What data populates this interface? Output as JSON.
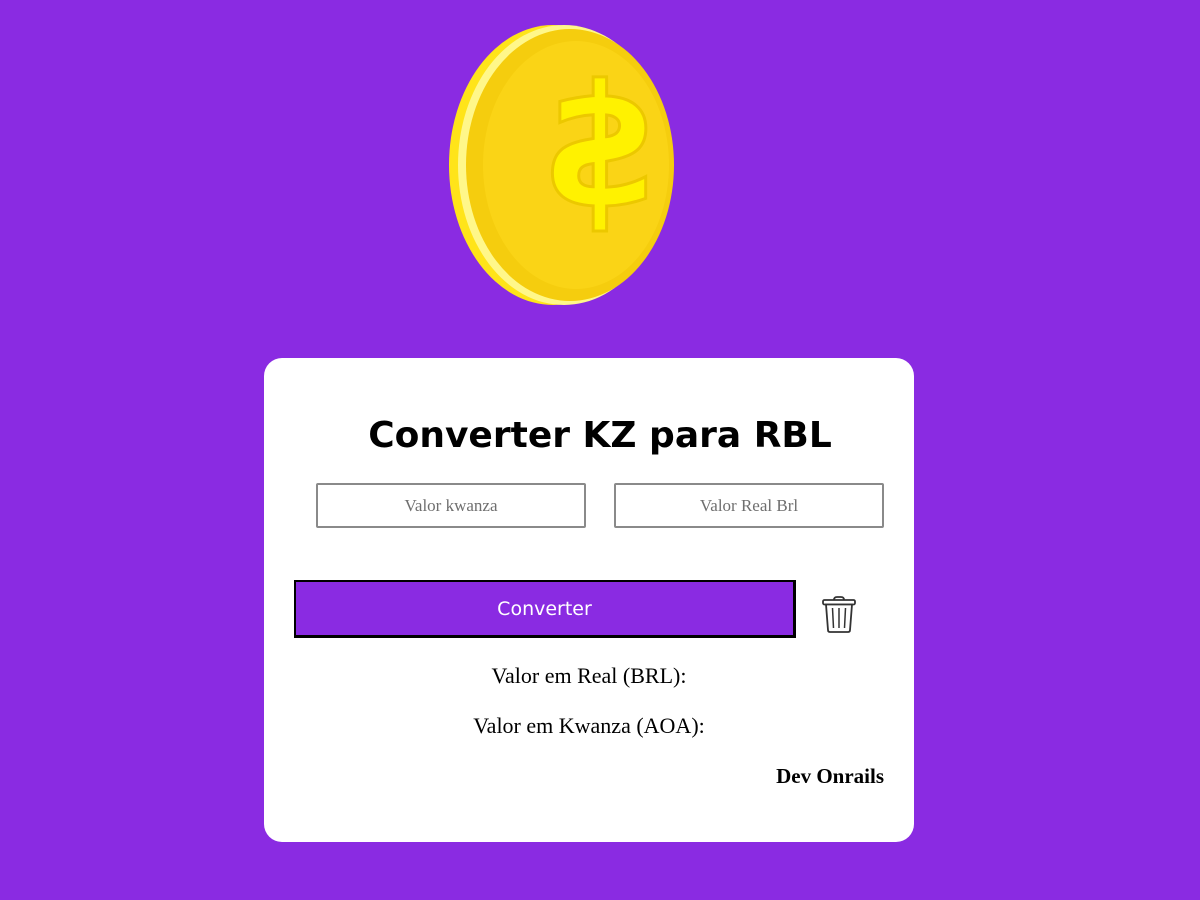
{
  "logo": {
    "icon": "gold-dollar-coin-icon"
  },
  "converter": {
    "title": "Converter KZ para RBL",
    "kwanza_placeholder": "Valor kwanza",
    "real_placeholder": "Valor Real Brl",
    "convert_label": "Converter",
    "clear_icon": "trash-icon",
    "result_brl_label": "Valor em Real (BRL):",
    "result_aoa_label": "Valor em Kwanza (AOA):",
    "credit": "Dev Onrails"
  },
  "colors": {
    "background": "#8a2be2",
    "card": "#ffffff",
    "button": "#8a2be2",
    "coin": "#f8d210"
  }
}
